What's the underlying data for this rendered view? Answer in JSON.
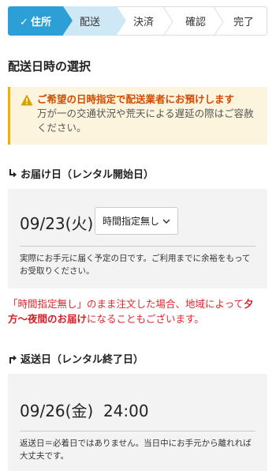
{
  "steps": [
    {
      "label": "住所",
      "state": "done"
    },
    {
      "label": "配送",
      "state": "current"
    },
    {
      "label": "決済",
      "state": "todo"
    },
    {
      "label": "確認",
      "state": "todo"
    },
    {
      "label": "完了",
      "state": "todo"
    }
  ],
  "page_title": "配送日時の選択",
  "notice": {
    "title": "ご希望の日時指定で配送業者にお預けします",
    "body": "万が一の交通状況や荒天による遅延の際はご容赦ください。"
  },
  "delivery": {
    "heading": "お届け日（レンタル開始日）",
    "date": "09/23(火)",
    "time_select_value": "時間指定無し",
    "note": "実際にお手元に届く予定の日です。ご利用までに余裕をもってお受取りください。"
  },
  "warning_note": {
    "part1": "「時間指定無し」のまま注文した場合、地域によって",
    "bold": "夕方〜夜間のお届け",
    "part2": "になることもございます。"
  },
  "return": {
    "heading": "返送日（レンタル終了日）",
    "datetime": "09/26(金)  24:00",
    "note": "返送日＝必着日ではありません。当日中にお手元から離れれば大丈夫です。"
  },
  "colors": {
    "accent": "#2b9fd6",
    "current_step": "#cfe8f5",
    "notice_bg": "#fcf4dc",
    "notice_title": "#d34a00",
    "red_text": "#e0272d"
  }
}
